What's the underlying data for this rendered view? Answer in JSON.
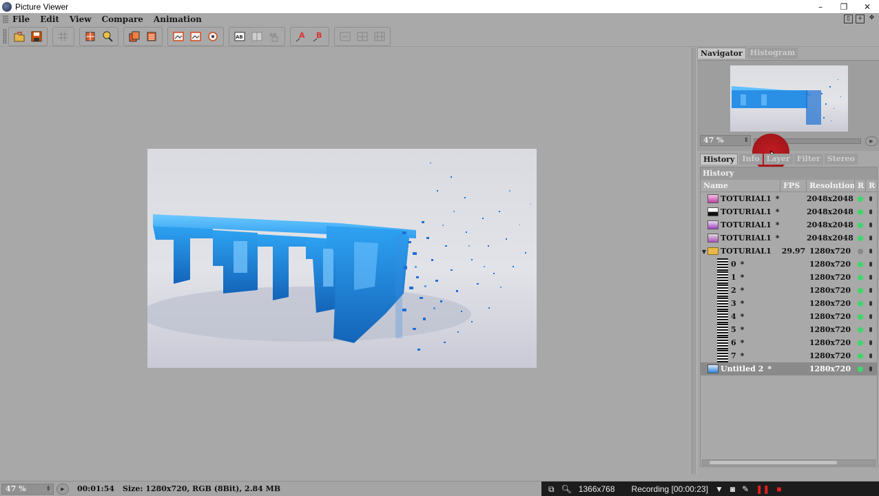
{
  "window": {
    "title": "Picture Viewer",
    "minimize": "–",
    "restore": "❐",
    "close": "✕"
  },
  "menu": {
    "items": [
      "File",
      "Edit",
      "View",
      "Compare",
      "Animation"
    ]
  },
  "toolbar": {
    "buttons": [
      "open",
      "save",
      "grid-toggle",
      "crop",
      "zoom",
      "layers",
      "multi-layer",
      "view-a",
      "view-b",
      "view-ab",
      "ab-compare",
      "ab-split",
      "ab-diff",
      "channel-a",
      "channel-b",
      "fit-1",
      "fit-2",
      "fit-3"
    ]
  },
  "navigator": {
    "tabs": [
      "Navigator",
      "Histogram"
    ],
    "zoom": "47 %"
  },
  "panel_tabs": [
    "History",
    "Info",
    "Layer",
    "Filter",
    "Stereo"
  ],
  "history": {
    "title": "History",
    "columns": [
      "Name",
      "FPS",
      "Resolution",
      "R",
      "Re"
    ],
    "rows": [
      {
        "name": "TOTURIAL1",
        "flag": "*",
        "fps": "",
        "res": "2048x2048",
        "thumb": "pink",
        "status": "green"
      },
      {
        "name": "TOTURIAL1",
        "flag": "*",
        "fps": "",
        "res": "2048x2048",
        "thumb": "dark",
        "status": "green"
      },
      {
        "name": "TOTURIAL1",
        "flag": "*",
        "fps": "",
        "res": "2048x2048",
        "thumb": "purple",
        "status": "green"
      },
      {
        "name": "TOTURIAL1",
        "flag": "*",
        "fps": "",
        "res": "2048x2048",
        "thumb": "purple2",
        "status": "green"
      },
      {
        "name": "TOTURIAL1",
        "flag": "",
        "fps": "29.97",
        "res": "1280x720",
        "thumb": "folder",
        "status": "grey"
      },
      {
        "name": "0",
        "flag": "*",
        "fps": "",
        "res": "1280x720",
        "thumb": "film",
        "status": "green"
      },
      {
        "name": "1",
        "flag": "*",
        "fps": "",
        "res": "1280x720",
        "thumb": "film",
        "status": "green"
      },
      {
        "name": "2",
        "flag": "*",
        "fps": "",
        "res": "1280x720",
        "thumb": "film",
        "status": "green"
      },
      {
        "name": "3",
        "flag": "*",
        "fps": "",
        "res": "1280x720",
        "thumb": "film",
        "status": "green"
      },
      {
        "name": "4",
        "flag": "*",
        "fps": "",
        "res": "1280x720",
        "thumb": "film",
        "status": "green"
      },
      {
        "name": "5",
        "flag": "*",
        "fps": "",
        "res": "1280x720",
        "thumb": "film",
        "status": "green"
      },
      {
        "name": "6",
        "flag": "*",
        "fps": "",
        "res": "1280x720",
        "thumb": "film",
        "status": "green"
      },
      {
        "name": "7",
        "flag": "*",
        "fps": "",
        "res": "1280x720",
        "thumb": "film",
        "status": "green"
      },
      {
        "name": "Untitled 2",
        "flag": "*",
        "fps": "",
        "res": "1280x720",
        "thumb": "blue",
        "status": "green",
        "selected": true
      }
    ]
  },
  "status": {
    "zoom": "47 %",
    "timecode": "00:01:54",
    "info": "Size: 1280x720, RGB (8Bit), 2.84 MB"
  },
  "recorder": {
    "resolution": "1366x768",
    "recording": "Recording [00:00:23]"
  },
  "colors": {
    "accent_green": "#3cd86a",
    "record_red": "#c4161c",
    "folder": "#e9b84b"
  }
}
